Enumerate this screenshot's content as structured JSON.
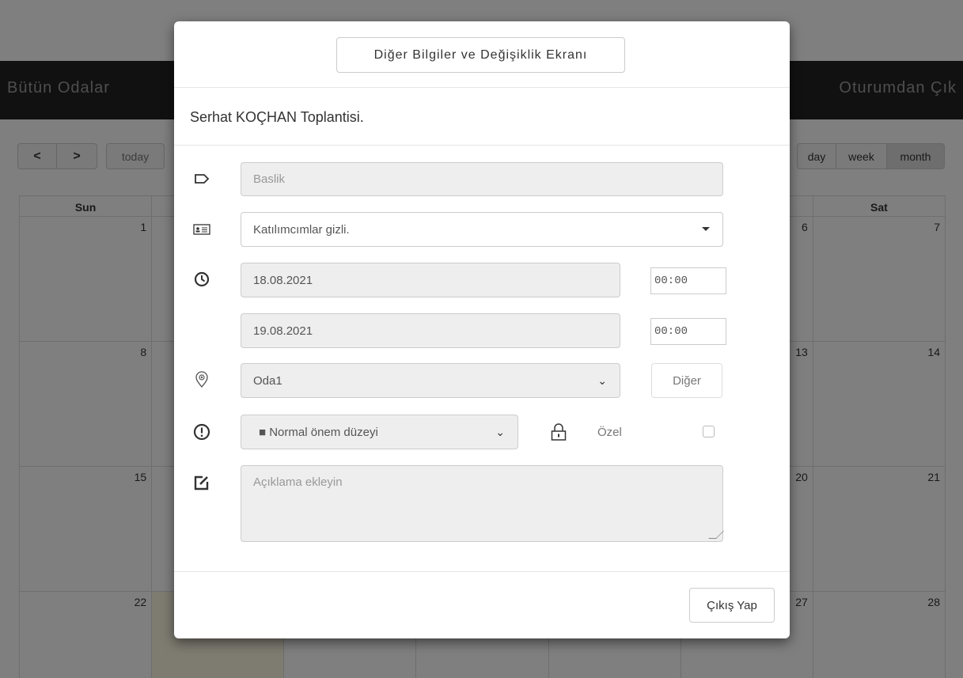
{
  "background": {
    "nav": {
      "brand": "Bütün Odalar",
      "logout": "Oturumdan Çık"
    },
    "toolbar": {
      "prev": "<",
      "next": ">",
      "today": "today",
      "views": [
        "day",
        "week",
        "month"
      ],
      "active_view": "month"
    },
    "calendar": {
      "days_of_week": [
        "Sun",
        "",
        "",
        "",
        "",
        "",
        "Sat"
      ],
      "weeks": [
        [
          "1",
          "",
          "",
          "",
          "",
          "6",
          "7"
        ],
        [
          "8",
          "",
          "",
          "",
          "",
          "13",
          "14"
        ],
        [
          "15",
          "",
          "",
          "",
          "",
          "20",
          "21"
        ],
        [
          "22",
          "",
          "",
          "",
          "",
          "27",
          "28"
        ]
      ]
    }
  },
  "modal": {
    "other_info_button": "Diğer Bilgiler ve Değişiklik Ekranı",
    "title": "Serhat KOÇHAN Toplantisi.",
    "title_field_placeholder": "Baslik",
    "participants_select": "Katılımcımlar gizli.",
    "start_date": "18.08.2021",
    "start_time": "00:00",
    "end_date": "19.08.2021",
    "end_time": "00:00",
    "room_select": "Oda1",
    "other_button": "Diğer",
    "priority_select": "■ Normal önem düzeyi",
    "private_label": "Özel",
    "private_checked": false,
    "description_placeholder": "Açıklama ekleyin",
    "exit_button": "Çıkış Yap"
  }
}
